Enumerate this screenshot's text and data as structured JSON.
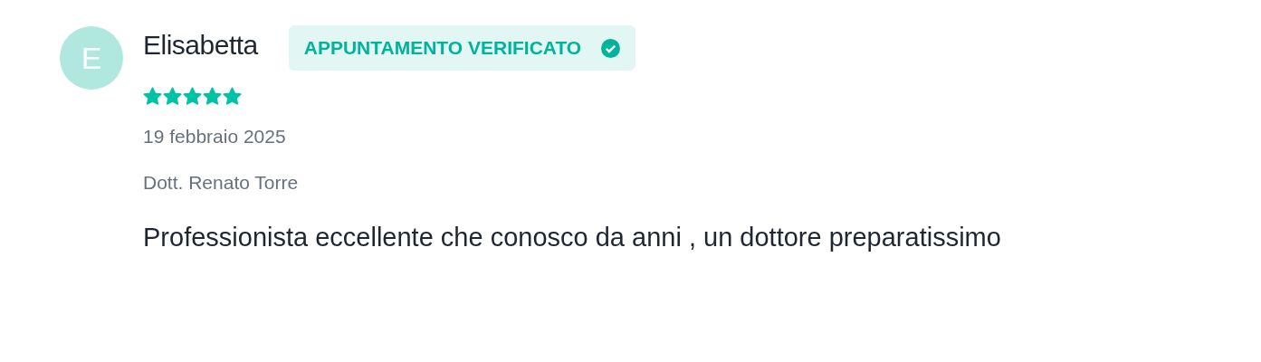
{
  "review": {
    "avatar": "E",
    "author": "Elisabetta",
    "badge": {
      "label": "APPUNTAMENTO VERIFICATO",
      "verified": true
    },
    "stars": 5,
    "date": "19 febbraio 2025",
    "doctor": "Dott. Renato Torre",
    "text": "Professionista eccellente che conosco da anni , un dottore preparatissimo"
  }
}
